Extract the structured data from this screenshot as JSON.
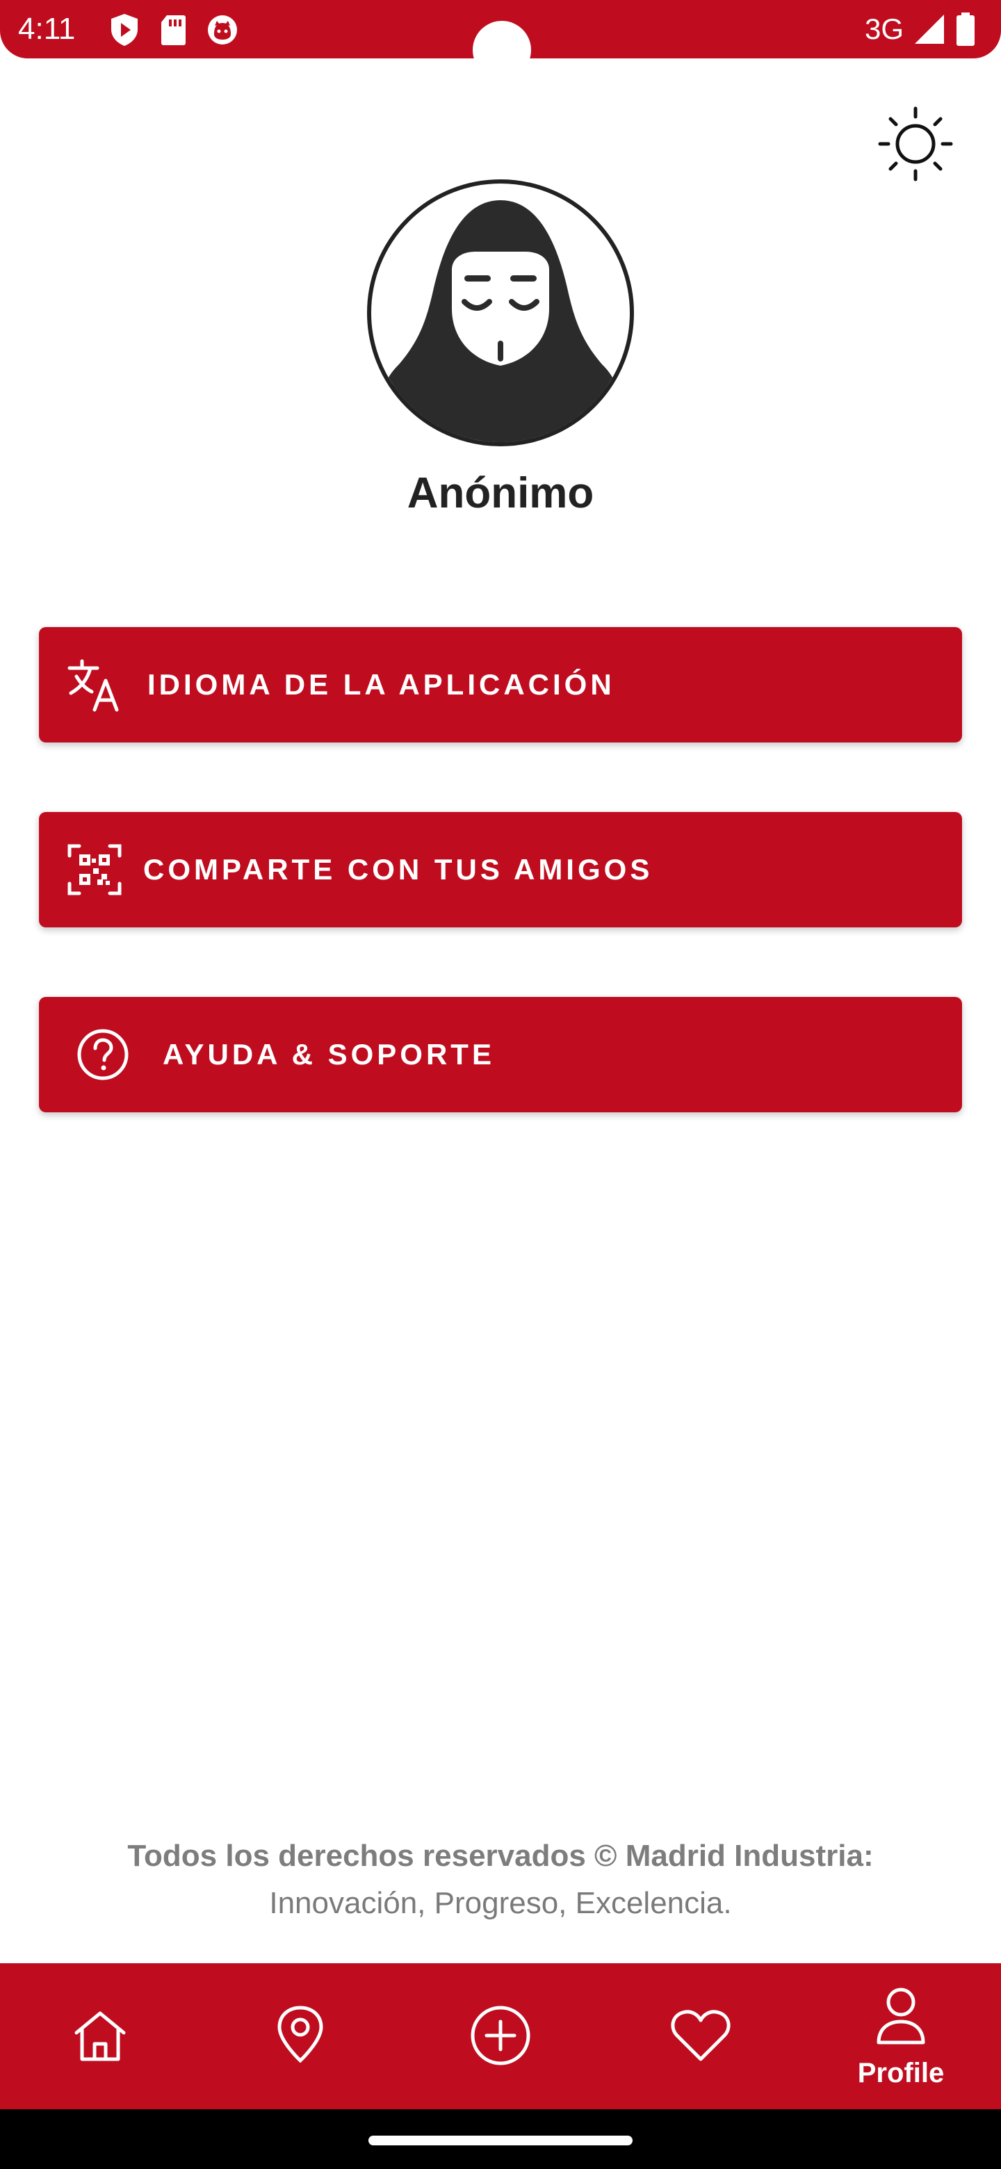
{
  "status_bar": {
    "time": "4:11",
    "network": "3G",
    "icons": [
      "shield-play-icon",
      "sd-card-icon",
      "cat-face-icon",
      "signal-icon",
      "battery-icon"
    ]
  },
  "header": {
    "theme_toggle_icon": "sun-icon"
  },
  "profile": {
    "avatar_icon": "anonymous-hood-mask-icon",
    "name": "Anónimo"
  },
  "menu": [
    {
      "label": "IDIOMA DE LA APLICACIÓN",
      "icon": "translate-icon"
    },
    {
      "label": "COMPARTE CON TUS AMIGOS",
      "icon": "qr-code-icon"
    },
    {
      "label": "AYUDA & SOPORTE",
      "icon": "help-circle-icon"
    }
  ],
  "footer": {
    "line1": "Todos los derechos reservados © Madrid Industria:",
    "line2": "Innovación, Progreso, Excelencia."
  },
  "bottom_nav": {
    "items": [
      {
        "icon": "home-icon",
        "label": ""
      },
      {
        "icon": "location-pin-icon",
        "label": ""
      },
      {
        "icon": "add-circle-icon",
        "label": ""
      },
      {
        "icon": "heart-icon",
        "label": ""
      },
      {
        "icon": "user-icon",
        "label": "Profile",
        "active": true
      }
    ]
  },
  "colors": {
    "brand_red": "#bf0d1f",
    "text_dark": "#222222",
    "footer_gray": "#7a7a7a"
  }
}
